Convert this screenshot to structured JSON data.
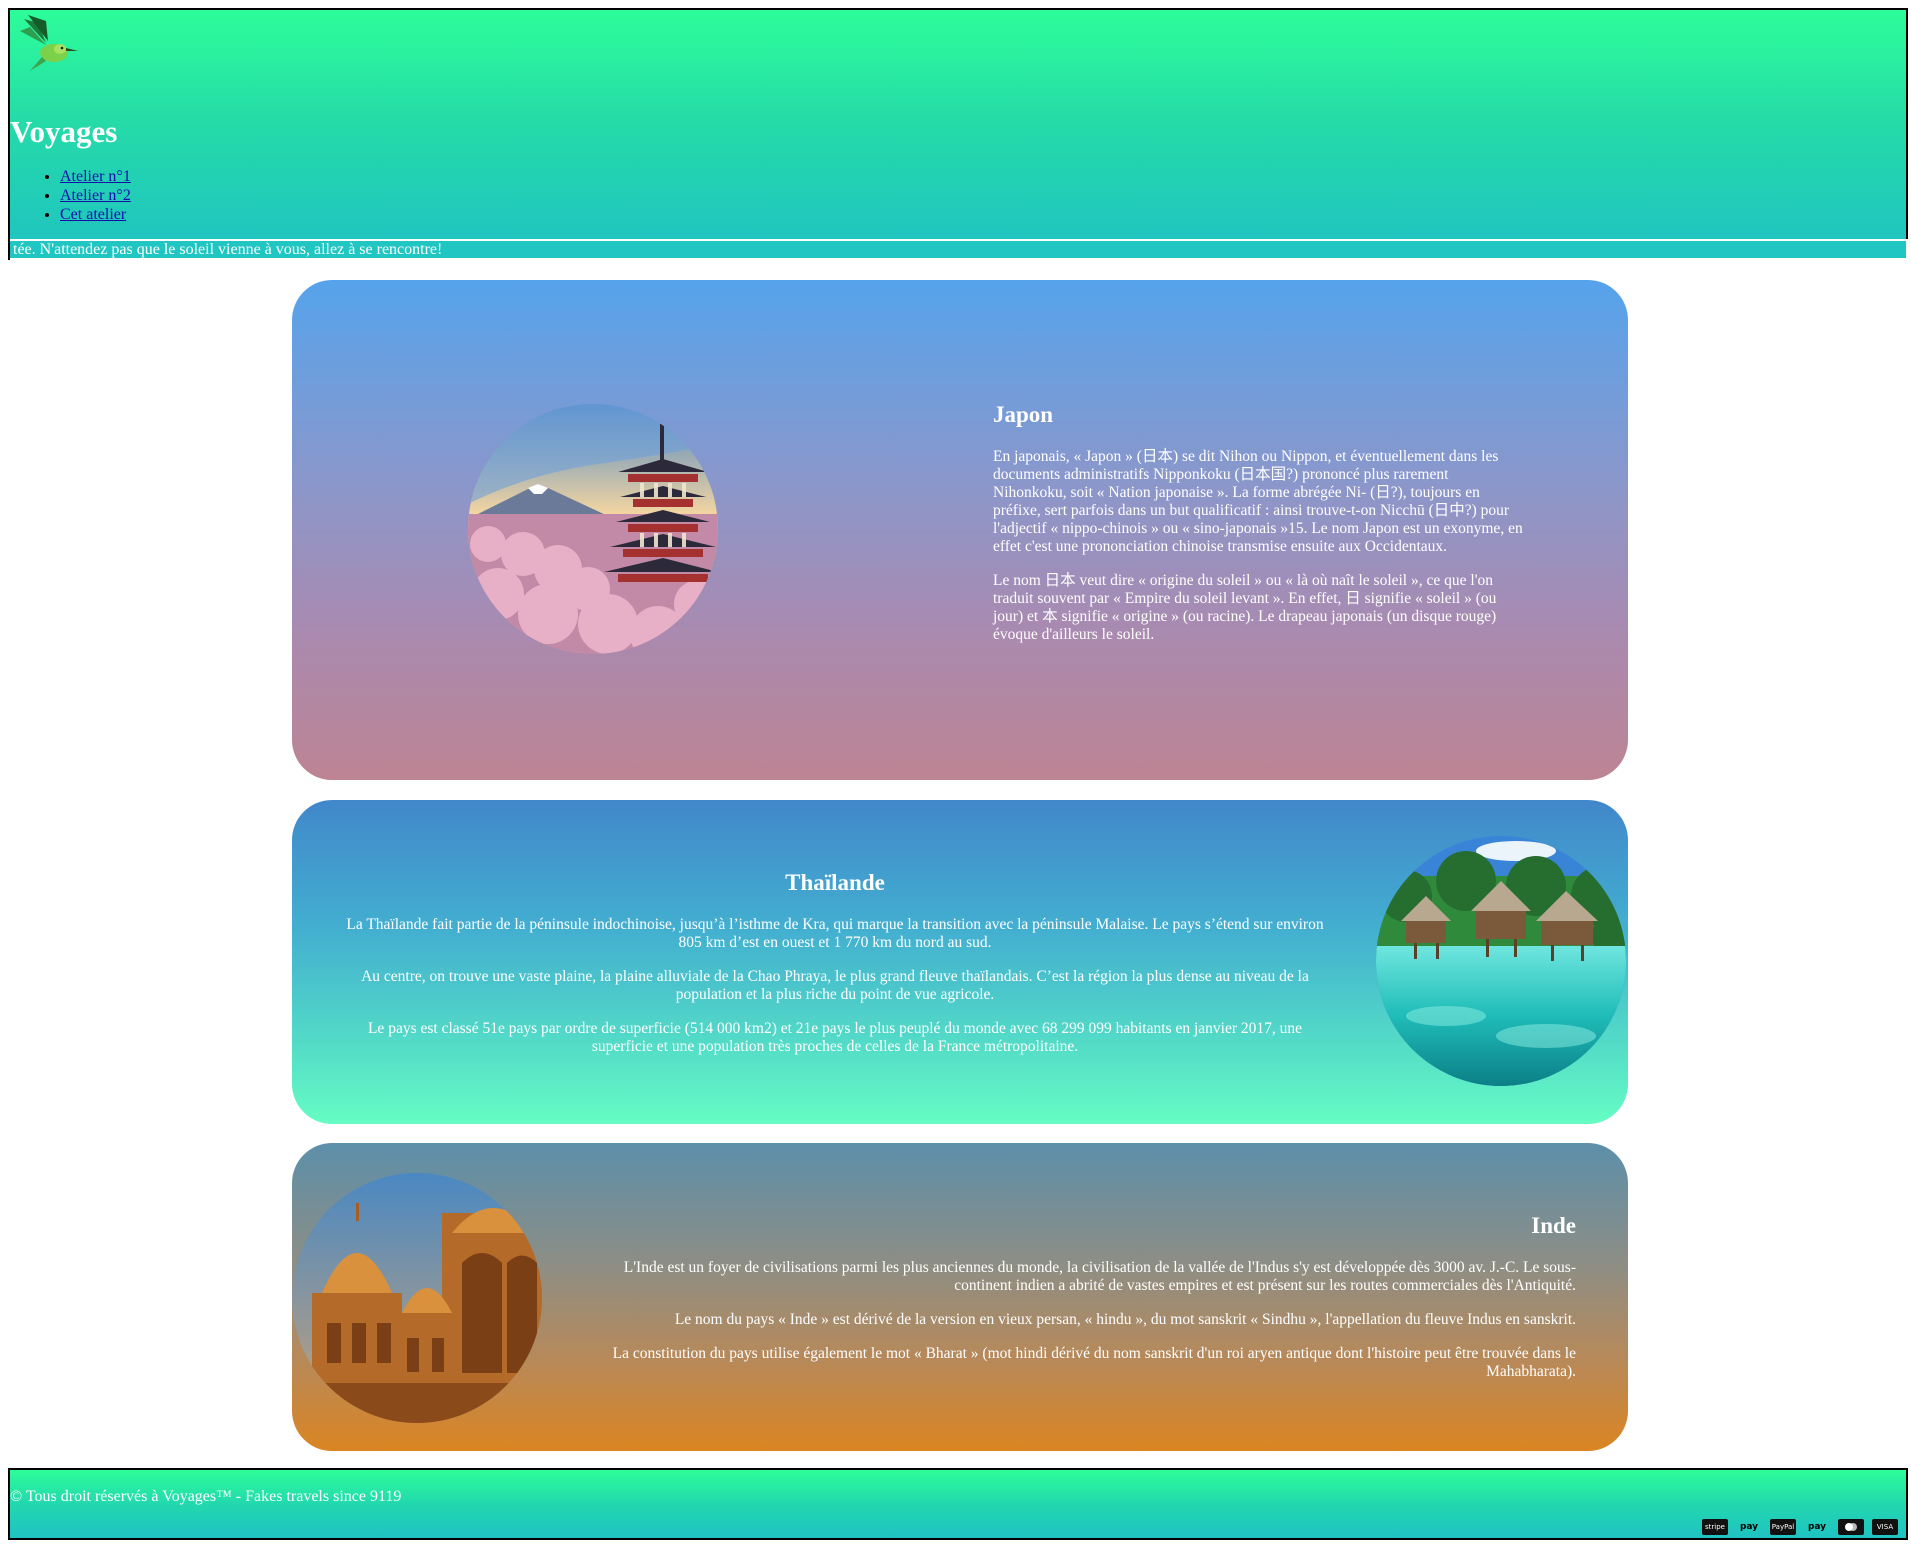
{
  "header": {
    "logo_icon": "hummingbird-logo-icon",
    "title": "Voyages",
    "nav": [
      {
        "label": "Atelier n°1"
      },
      {
        "label": "Atelier n°2"
      },
      {
        "label": "Cet atelier"
      }
    ],
    "marquee": "tée. N'attendez pas que le soleil vienne à vous, allez à se rencontre!"
  },
  "cards": [
    {
      "id": "japon",
      "title": "Japon",
      "image_icon": "japan-pagoda-fuji-photo",
      "paragraphs": [
        "En japonais, « Japon » (日本) se dit Nihon ou Nippon, et éventuellement dans les documents administratifs Nipponkoku (日本国?) prononcé plus rarement Nihonkoku, soit « Nation japonaise ». La forme abrégée Ni- (日?), toujours en préfixe, sert parfois dans un but qualificatif : ainsi trouve-t-on Nicchū (日中?) pour l'adjectif « nippo-chinois » ou « sino-japonais »15. Le nom Japon est un exonyme, en effet c'est une prononciation chinoise transmise ensuite aux Occidentaux.",
        "Le nom 日本 veut dire « origine du soleil » ou « là où naît le soleil », ce que l'on traduit souvent par « Empire du soleil levant ». En effet, 日 signifie « soleil » (ou jour) et 本 signifie « origine » (ou racine). Le drapeau japonais (un disque rouge) évoque d'ailleurs le soleil."
      ]
    },
    {
      "id": "thailande",
      "title": "Thaïlande",
      "image_icon": "tropical-lagoon-bungalows-photo",
      "paragraphs": [
        "La Thaïlande fait partie de la péninsule indochinoise, jusqu’à l’isthme de Kra, qui marque la transition avec la péninsule Malaise. Le pays s’étend sur environ 805 km d’est en ouest et 1 770 km du nord au sud.",
        "Au centre, on trouve une vaste plaine, la plaine alluviale de la Chao Phraya, le plus grand fleuve thaïlandais. C’est la région la plus dense au niveau de la population et la plus riche du point de vue agricole.",
        "Le pays est classé 51e pays par ordre de superficie (514 000 km2) et 21e pays le plus peuplé du monde avec 68 299 099 habitants en janvier 2017, une superficie et une population très proches de celles de la France métropolitaine."
      ]
    },
    {
      "id": "inde",
      "title": "Inde",
      "image_icon": "india-temple-domes-photo",
      "paragraphs": [
        "L'Inde est un foyer de civilisations parmi les plus anciennes du monde, la civilisation de la vallée de l'Indus s'y est développée dès 3000 av. J.-C. Le sous-continent indien a abrité de vastes empires et est présent sur les routes commerciales dès l'Antiquité.",
        "Le nom du pays « Inde » est dérivé de la version en vieux persan, « hindu », du mot sanskrit « Sindhu », l'appellation du fleuve Indus en sanskrit.",
        "La constitution du pays utilise également le mot « Bharat » (mot hindi dérivé du nom sanskrit d'un roi aryen antique dont l'histoire peut être trouvée dans le Mahabharata)."
      ]
    }
  ],
  "footer": {
    "copyright": "© Tous droit réservés à Voyages™ - Fakes travels since 9119",
    "payments": [
      {
        "icon": "stripe-icon",
        "label": "stripe"
      },
      {
        "icon": "apple-pay-icon",
        "label": "pay"
      },
      {
        "icon": "paypal-icon",
        "label": "PayPal"
      },
      {
        "icon": "amazon-pay-icon",
        "label": "pay"
      },
      {
        "icon": "mastercard-icon",
        "label": ""
      },
      {
        "icon": "visa-icon",
        "label": "VISA"
      }
    ]
  },
  "colors": {
    "header_gradient_top": "#2dfd99",
    "header_gradient_bottom": "#1fc2c3",
    "japon_top": "#55a3ec",
    "japon_bottom": "#bd8493",
    "thai_top": "#4187ca",
    "thai_bottom": "#66fdc4",
    "inde_top": "#5c8faa",
    "inde_bottom": "#db8522"
  }
}
